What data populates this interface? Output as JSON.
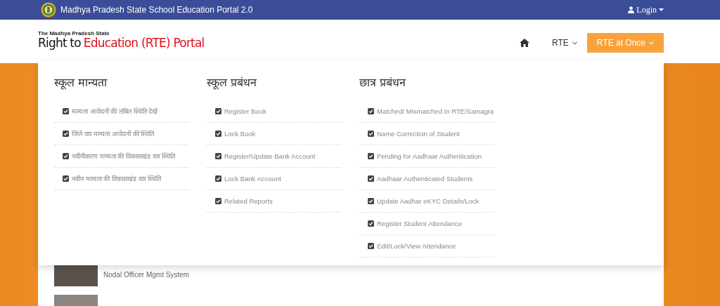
{
  "top_bar": {
    "title": "Madhya Pradesh State School Education Portal 2.0",
    "login": "Login"
  },
  "logo": {
    "tagline": "The Madhya Pradesh State",
    "title_dark": "Right to",
    "title_red": "Education (RTE) Portal"
  },
  "nav": [
    {
      "kind": "home",
      "selected": false
    },
    {
      "kind": "dropdown",
      "label": "RTE",
      "selected": false
    },
    {
      "kind": "dropdown",
      "label": "RTE at Once",
      "selected": true
    }
  ],
  "menu": {
    "columns": [
      {
        "heading": "स्कूल मान्यता",
        "items": [
          "मान्यता आवेदनों की लंबित स्थिति देखें",
          "जिले वार मान्यता आवेदनों की स्थिति",
          "नवीनीकरण मान्यता की विकासखंड वार स्थिति",
          "नवीन मान्यता की विकासखंड वार स्थिति"
        ]
      },
      {
        "heading": "स्कूल प्रबंधन",
        "items": [
          "Register Book",
          "Lock Book",
          "Register/Update Bank Account",
          "Lock Bank Account",
          "Related Reports"
        ]
      },
      {
        "heading": "छात्र प्रबंधन",
        "items": [
          "Matched/ Mismatched In RTE/Samagra",
          "Name Correction of Student",
          "Pending for Aadhaar Authentication",
          "Aadhaar Authenticated Students",
          "Update Aadhar eKYC Details/Lock",
          "Register Student Attendance",
          "Edit/Lock/View Attendance"
        ]
      }
    ]
  },
  "content": {
    "caption": "Nodal Officer Mgmt System"
  }
}
